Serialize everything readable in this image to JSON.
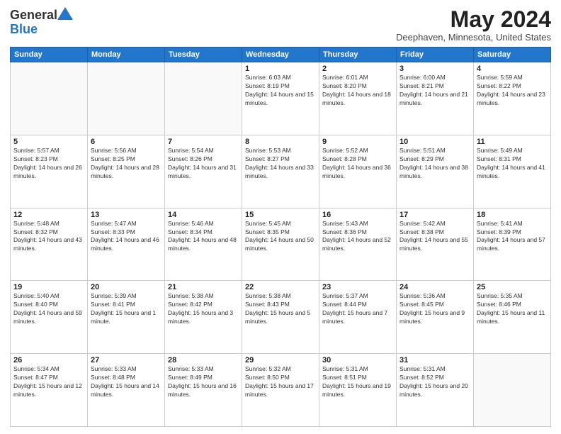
{
  "header": {
    "logo_general": "General",
    "logo_blue": "Blue",
    "month": "May 2024",
    "location": "Deephaven, Minnesota, United States"
  },
  "weekdays": [
    "Sunday",
    "Monday",
    "Tuesday",
    "Wednesday",
    "Thursday",
    "Friday",
    "Saturday"
  ],
  "weeks": [
    [
      {
        "day": "",
        "sunrise": "",
        "sunset": "",
        "daylight": "",
        "empty": true
      },
      {
        "day": "",
        "sunrise": "",
        "sunset": "",
        "daylight": "",
        "empty": true
      },
      {
        "day": "",
        "sunrise": "",
        "sunset": "",
        "daylight": "",
        "empty": true
      },
      {
        "day": "1",
        "sunrise": "Sunrise: 6:03 AM",
        "sunset": "Sunset: 8:19 PM",
        "daylight": "Daylight: 14 hours and 15 minutes.",
        "empty": false
      },
      {
        "day": "2",
        "sunrise": "Sunrise: 6:01 AM",
        "sunset": "Sunset: 8:20 PM",
        "daylight": "Daylight: 14 hours and 18 minutes.",
        "empty": false
      },
      {
        "day": "3",
        "sunrise": "Sunrise: 6:00 AM",
        "sunset": "Sunset: 8:21 PM",
        "daylight": "Daylight: 14 hours and 21 minutes.",
        "empty": false
      },
      {
        "day": "4",
        "sunrise": "Sunrise: 5:59 AM",
        "sunset": "Sunset: 8:22 PM",
        "daylight": "Daylight: 14 hours and 23 minutes.",
        "empty": false
      }
    ],
    [
      {
        "day": "5",
        "sunrise": "Sunrise: 5:57 AM",
        "sunset": "Sunset: 8:23 PM",
        "daylight": "Daylight: 14 hours and 26 minutes.",
        "empty": false
      },
      {
        "day": "6",
        "sunrise": "Sunrise: 5:56 AM",
        "sunset": "Sunset: 8:25 PM",
        "daylight": "Daylight: 14 hours and 28 minutes.",
        "empty": false
      },
      {
        "day": "7",
        "sunrise": "Sunrise: 5:54 AM",
        "sunset": "Sunset: 8:26 PM",
        "daylight": "Daylight: 14 hours and 31 minutes.",
        "empty": false
      },
      {
        "day": "8",
        "sunrise": "Sunrise: 5:53 AM",
        "sunset": "Sunset: 8:27 PM",
        "daylight": "Daylight: 14 hours and 33 minutes.",
        "empty": false
      },
      {
        "day": "9",
        "sunrise": "Sunrise: 5:52 AM",
        "sunset": "Sunset: 8:28 PM",
        "daylight": "Daylight: 14 hours and 36 minutes.",
        "empty": false
      },
      {
        "day": "10",
        "sunrise": "Sunrise: 5:51 AM",
        "sunset": "Sunset: 8:29 PM",
        "daylight": "Daylight: 14 hours and 38 minutes.",
        "empty": false
      },
      {
        "day": "11",
        "sunrise": "Sunrise: 5:49 AM",
        "sunset": "Sunset: 8:31 PM",
        "daylight": "Daylight: 14 hours and 41 minutes.",
        "empty": false
      }
    ],
    [
      {
        "day": "12",
        "sunrise": "Sunrise: 5:48 AM",
        "sunset": "Sunset: 8:32 PM",
        "daylight": "Daylight: 14 hours and 43 minutes.",
        "empty": false
      },
      {
        "day": "13",
        "sunrise": "Sunrise: 5:47 AM",
        "sunset": "Sunset: 8:33 PM",
        "daylight": "Daylight: 14 hours and 46 minutes.",
        "empty": false
      },
      {
        "day": "14",
        "sunrise": "Sunrise: 5:46 AM",
        "sunset": "Sunset: 8:34 PM",
        "daylight": "Daylight: 14 hours and 48 minutes.",
        "empty": false
      },
      {
        "day": "15",
        "sunrise": "Sunrise: 5:45 AM",
        "sunset": "Sunset: 8:35 PM",
        "daylight": "Daylight: 14 hours and 50 minutes.",
        "empty": false
      },
      {
        "day": "16",
        "sunrise": "Sunrise: 5:43 AM",
        "sunset": "Sunset: 8:36 PM",
        "daylight": "Daylight: 14 hours and 52 minutes.",
        "empty": false
      },
      {
        "day": "17",
        "sunrise": "Sunrise: 5:42 AM",
        "sunset": "Sunset: 8:38 PM",
        "daylight": "Daylight: 14 hours and 55 minutes.",
        "empty": false
      },
      {
        "day": "18",
        "sunrise": "Sunrise: 5:41 AM",
        "sunset": "Sunset: 8:39 PM",
        "daylight": "Daylight: 14 hours and 57 minutes.",
        "empty": false
      }
    ],
    [
      {
        "day": "19",
        "sunrise": "Sunrise: 5:40 AM",
        "sunset": "Sunset: 8:40 PM",
        "daylight": "Daylight: 14 hours and 59 minutes.",
        "empty": false
      },
      {
        "day": "20",
        "sunrise": "Sunrise: 5:39 AM",
        "sunset": "Sunset: 8:41 PM",
        "daylight": "Daylight: 15 hours and 1 minute.",
        "empty": false
      },
      {
        "day": "21",
        "sunrise": "Sunrise: 5:38 AM",
        "sunset": "Sunset: 8:42 PM",
        "daylight": "Daylight: 15 hours and 3 minutes.",
        "empty": false
      },
      {
        "day": "22",
        "sunrise": "Sunrise: 5:38 AM",
        "sunset": "Sunset: 8:43 PM",
        "daylight": "Daylight: 15 hours and 5 minutes.",
        "empty": false
      },
      {
        "day": "23",
        "sunrise": "Sunrise: 5:37 AM",
        "sunset": "Sunset: 8:44 PM",
        "daylight": "Daylight: 15 hours and 7 minutes.",
        "empty": false
      },
      {
        "day": "24",
        "sunrise": "Sunrise: 5:36 AM",
        "sunset": "Sunset: 8:45 PM",
        "daylight": "Daylight: 15 hours and 9 minutes.",
        "empty": false
      },
      {
        "day": "25",
        "sunrise": "Sunrise: 5:35 AM",
        "sunset": "Sunset: 8:46 PM",
        "daylight": "Daylight: 15 hours and 11 minutes.",
        "empty": false
      }
    ],
    [
      {
        "day": "26",
        "sunrise": "Sunrise: 5:34 AM",
        "sunset": "Sunset: 8:47 PM",
        "daylight": "Daylight: 15 hours and 12 minutes.",
        "empty": false
      },
      {
        "day": "27",
        "sunrise": "Sunrise: 5:33 AM",
        "sunset": "Sunset: 8:48 PM",
        "daylight": "Daylight: 15 hours and 14 minutes.",
        "empty": false
      },
      {
        "day": "28",
        "sunrise": "Sunrise: 5:33 AM",
        "sunset": "Sunset: 8:49 PM",
        "daylight": "Daylight: 15 hours and 16 minutes.",
        "empty": false
      },
      {
        "day": "29",
        "sunrise": "Sunrise: 5:32 AM",
        "sunset": "Sunset: 8:50 PM",
        "daylight": "Daylight: 15 hours and 17 minutes.",
        "empty": false
      },
      {
        "day": "30",
        "sunrise": "Sunrise: 5:31 AM",
        "sunset": "Sunset: 8:51 PM",
        "daylight": "Daylight: 15 hours and 19 minutes.",
        "empty": false
      },
      {
        "day": "31",
        "sunrise": "Sunrise: 5:31 AM",
        "sunset": "Sunset: 8:52 PM",
        "daylight": "Daylight: 15 hours and 20 minutes.",
        "empty": false
      },
      {
        "day": "",
        "sunrise": "",
        "sunset": "",
        "daylight": "",
        "empty": true
      }
    ]
  ]
}
